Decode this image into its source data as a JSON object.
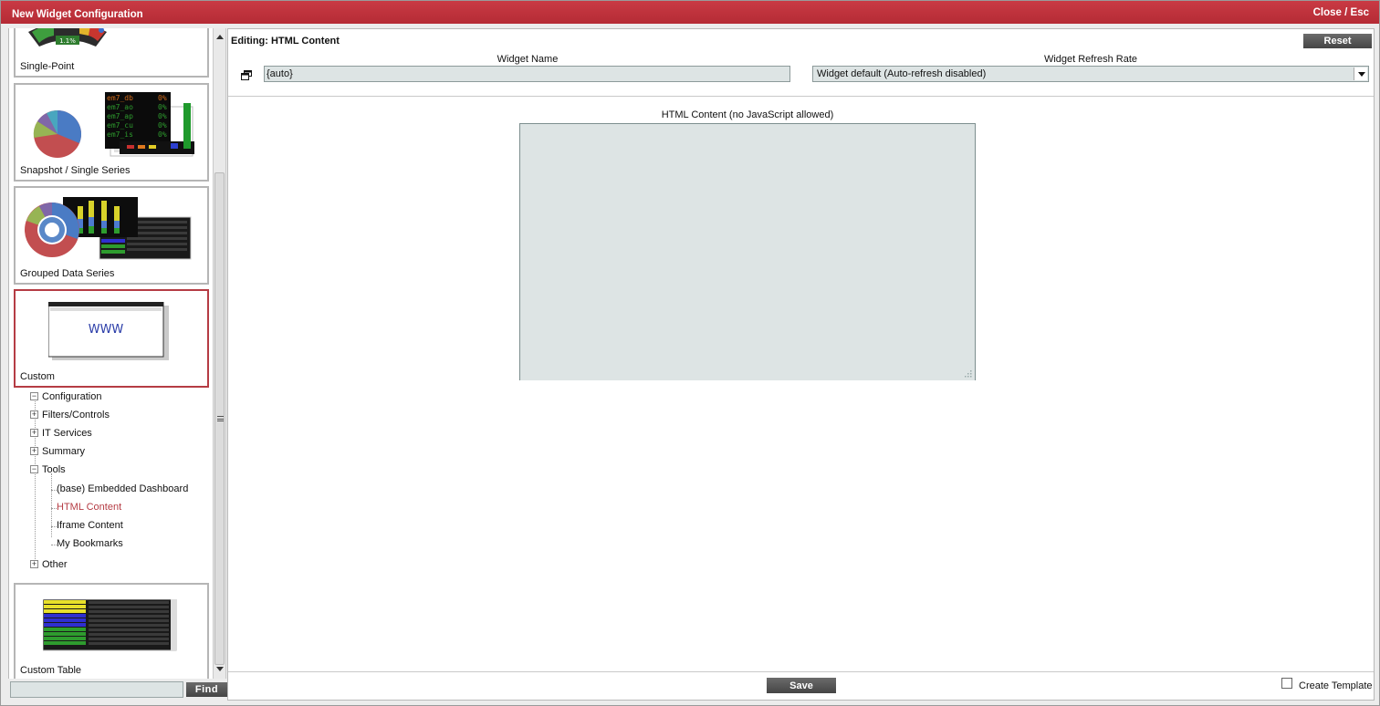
{
  "window": {
    "title": "New Widget Configuration",
    "close_label": "Close / Esc"
  },
  "left_panel": {
    "cards": [
      {
        "label": "Single-Point",
        "gauge_text": "1.1%"
      },
      {
        "label": "Snapshot / Single Series",
        "thumb_rows": [
          "em7_db",
          "em7_ao",
          "em7_ap",
          "em7_cu",
          "em7_is"
        ],
        "thumb_values": [
          "0%",
          "0%",
          "0%",
          "0%",
          "0%"
        ]
      },
      {
        "label": "Grouped Data Series"
      },
      {
        "label": "Custom",
        "thumb_text": "WWW"
      },
      {
        "label": "Custom Table"
      }
    ],
    "tree": {
      "groups": [
        {
          "label": "Configuration",
          "expander": "−"
        },
        {
          "label": "Filters/Controls",
          "expander": "+"
        },
        {
          "label": "IT Services",
          "expander": "+"
        },
        {
          "label": "Summary",
          "expander": "+"
        },
        {
          "label": "Tools",
          "expander": "−"
        },
        {
          "label": "Other",
          "expander": "+"
        }
      ],
      "tools_children": [
        {
          "label": "(base) Embedded Dashboard"
        },
        {
          "label": "HTML Content"
        },
        {
          "label": "Iframe Content"
        },
        {
          "label": "My Bookmarks"
        }
      ]
    },
    "find": {
      "value": "",
      "button_label": "Find"
    }
  },
  "main": {
    "editing_title": "Editing: HTML Content",
    "reset_label": "Reset",
    "widget_name": {
      "label": "Widget Name",
      "value": "{auto}"
    },
    "refresh_rate": {
      "label": "Widget Refresh Rate",
      "value": "Widget default (Auto-refresh disabled)"
    },
    "html_content": {
      "label": "HTML Content (no JavaScript allowed)",
      "value": ""
    },
    "save_label": "Save",
    "create_template_label": "Create Template",
    "create_template_checked": false
  },
  "colors": {
    "title_bar": "#b8303a",
    "selected_border": "#b53c44",
    "active_tree_item": "#b53c44",
    "field_bg": "#dde4e4",
    "button_bg": "#555555"
  }
}
